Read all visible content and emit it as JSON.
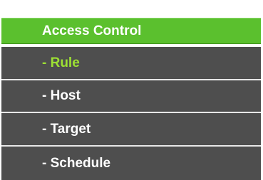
{
  "menu": {
    "header_label": "Access Control",
    "items": [
      {
        "label": "- Rule",
        "active": true
      },
      {
        "label": "- Host",
        "active": false
      },
      {
        "label": "- Target",
        "active": false
      },
      {
        "label": "- Schedule",
        "active": false
      }
    ]
  },
  "colors": {
    "header_bg": "#5bc02e",
    "item_bg": "#4e4e4e",
    "active_text": "#9de034",
    "text": "#ffffff"
  }
}
